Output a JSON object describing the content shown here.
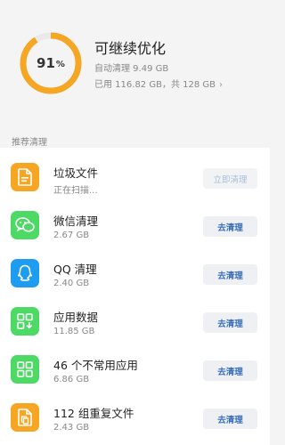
{
  "status": {
    "percent": 91,
    "percent_number": "91",
    "percent_unit": "%",
    "title": "可继续优化",
    "auto_clean": "自动清理 9.49 GB",
    "usage": "已用 116.82 GB，共 128 GB",
    "ring_color": "#f5a623",
    "ring_track_color": "#e9e9e9"
  },
  "section": {
    "label": "推荐清理"
  },
  "items": [
    {
      "title": "垃圾文件",
      "sub": "正在扫描...",
      "button": "立即清理",
      "icon": "document-icon",
      "color": "#f6a623",
      "button_enabled": false
    },
    {
      "title": "微信清理",
      "sub": "2.67 GB",
      "button": "去清理",
      "icon": "wechat-icon",
      "color": "#4cd964",
      "button_enabled": true
    },
    {
      "title": "QQ 清理",
      "sub": "2.40 GB",
      "button": "去清理",
      "icon": "qq-icon",
      "color": "#1e9cf0",
      "button_enabled": true
    },
    {
      "title": "应用数据",
      "sub": "11.85 GB",
      "button": "去清理",
      "icon": "app-data-icon",
      "color": "#4cd964",
      "button_enabled": true
    },
    {
      "title": "46 个不常用应用",
      "sub": "6.86 GB",
      "button": "去清理",
      "icon": "apps-grid-icon",
      "color": "#4cd964",
      "button_enabled": true
    },
    {
      "title": "112 组重复文件",
      "sub": "2.43 GB",
      "button": "去清理",
      "icon": "duplicate-file-icon",
      "color": "#f6a623",
      "button_enabled": true
    }
  ]
}
